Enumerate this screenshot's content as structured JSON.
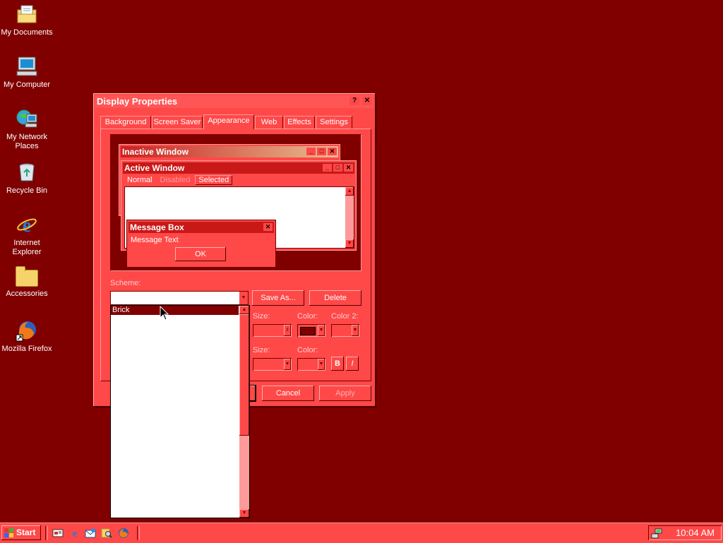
{
  "desktop": {
    "icons": [
      {
        "label": "My Documents",
        "icon": "my-documents-icon"
      },
      {
        "label": "My Computer",
        "icon": "my-computer-icon"
      },
      {
        "label_line1": "My Network",
        "label_line2": "Places",
        "icon": "network-places-icon"
      },
      {
        "label": "Recycle Bin",
        "icon": "recycle-bin-icon"
      },
      {
        "label_line1": "Internet",
        "label_line2": "Explorer",
        "icon": "internet-explorer-icon"
      },
      {
        "label": "Accessories",
        "icon": "folder-icon"
      },
      {
        "label": "Mozilla Firefox",
        "icon": "firefox-icon"
      }
    ]
  },
  "dialog": {
    "title": "Display Properties",
    "help_btn": "?",
    "close_btn": "✕",
    "tabs": [
      "Background",
      "Screen Saver",
      "Appearance",
      "Web",
      "Effects",
      "Settings"
    ],
    "active_tab": "Appearance",
    "preview": {
      "inactive_title": "Inactive Window",
      "active_title": "Active Window",
      "menu_normal": "Normal",
      "menu_disabled": "Disabled",
      "menu_selected": "Selected",
      "msgbox_title": "Message Box",
      "msgbox_text": "Message Text",
      "msgbox_ok": "OK"
    },
    "scheme_label": "Scheme:",
    "scheme_value": "",
    "save_as_label": "Save As...",
    "delete_label": "Delete",
    "item_size_label": "Size:",
    "color_label": "Color:",
    "color2_label": "Color 2:",
    "font_size_label": "Size:",
    "font_color_label": "Color:",
    "bold_label": "B",
    "italic_label": "I",
    "cancel_label": "Cancel",
    "apply_label": "Apply"
  },
  "scheme_dropdown": {
    "options": [
      "Brick"
    ],
    "selected": "Brick"
  },
  "taskbar": {
    "start_label": "Start",
    "quick_launch": [
      "show-desktop-icon",
      "internet-explorer-icon",
      "outlook-express-icon",
      "search-icon",
      "firefox-icon"
    ],
    "clock": "10:04 AM"
  },
  "colors": {
    "desktop": "#800000",
    "window_face": "#ff4848",
    "selection": "#800000"
  }
}
